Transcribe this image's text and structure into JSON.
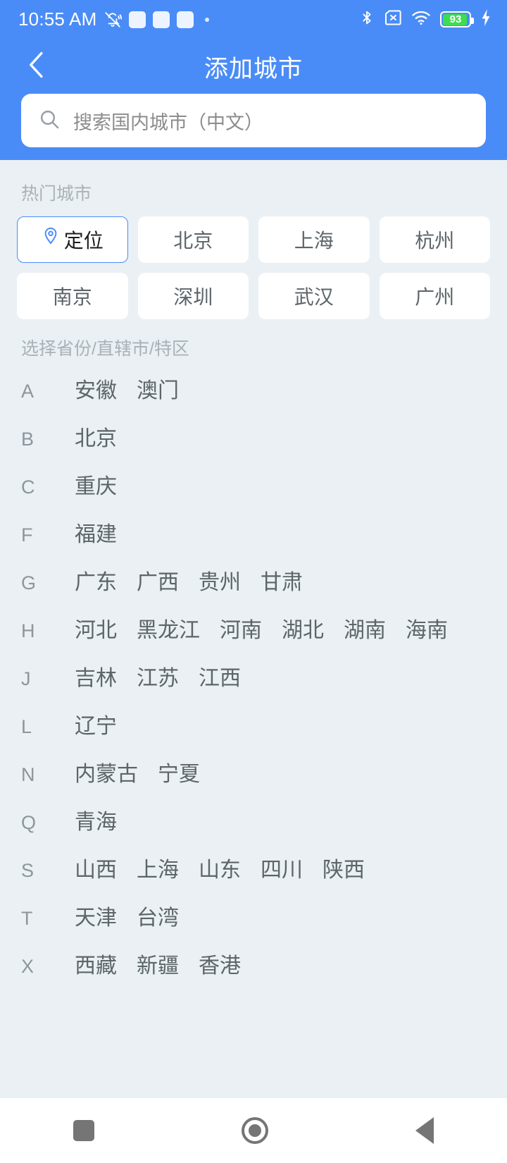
{
  "status_bar": {
    "time": "10:55 AM",
    "battery_percent": "93",
    "icons": [
      "bell-mute-icon",
      "placeholder-icon",
      "placeholder-icon",
      "placeholder-icon",
      "dot-icon",
      "bluetooth-icon",
      "sim-missing-icon",
      "wifi-icon",
      "battery-icon",
      "charging-bolt-icon"
    ]
  },
  "header": {
    "title": "添加城市",
    "back_icon": "chevron-left-icon",
    "accent_color": "#4a8cf7"
  },
  "search": {
    "placeholder": "搜索国内城市（中文）",
    "value": "",
    "icon": "search-icon"
  },
  "hot_cities": {
    "label": "热门城市",
    "items": [
      {
        "label": "定位",
        "icon": "location-pin-icon",
        "selected": true
      },
      {
        "label": "北京",
        "icon": "",
        "selected": false
      },
      {
        "label": "上海",
        "icon": "",
        "selected": false
      },
      {
        "label": "杭州",
        "icon": "",
        "selected": false
      },
      {
        "label": "南京",
        "icon": "",
        "selected": false
      },
      {
        "label": "深圳",
        "icon": "",
        "selected": false
      },
      {
        "label": "武汉",
        "icon": "",
        "selected": false
      },
      {
        "label": "广州",
        "icon": "",
        "selected": false
      }
    ]
  },
  "provinces": {
    "label": "选择省份/直辖市/特区",
    "groups": [
      {
        "letter": "A",
        "names": [
          "安徽",
          "澳门"
        ]
      },
      {
        "letter": "B",
        "names": [
          "北京"
        ]
      },
      {
        "letter": "C",
        "names": [
          "重庆"
        ]
      },
      {
        "letter": "F",
        "names": [
          "福建"
        ]
      },
      {
        "letter": "G",
        "names": [
          "广东",
          "广西",
          "贵州",
          "甘肃"
        ]
      },
      {
        "letter": "H",
        "names": [
          "河北",
          "黑龙江",
          "河南",
          "湖北",
          "湖南",
          "海南"
        ]
      },
      {
        "letter": "J",
        "names": [
          "吉林",
          "江苏",
          "江西"
        ]
      },
      {
        "letter": "L",
        "names": [
          "辽宁"
        ]
      },
      {
        "letter": "N",
        "names": [
          "内蒙古",
          "宁夏"
        ]
      },
      {
        "letter": "Q",
        "names": [
          "青海"
        ]
      },
      {
        "letter": "S",
        "names": [
          "山西",
          "上海",
          "山东",
          "四川",
          "陕西"
        ]
      },
      {
        "letter": "T",
        "names": [
          "天津",
          "台湾"
        ]
      },
      {
        "letter": "X",
        "names": [
          "西藏",
          "新疆",
          "香港"
        ]
      }
    ]
  },
  "nav_bar": {
    "recents_label": "recents",
    "home_label": "home",
    "back_label": "back"
  }
}
